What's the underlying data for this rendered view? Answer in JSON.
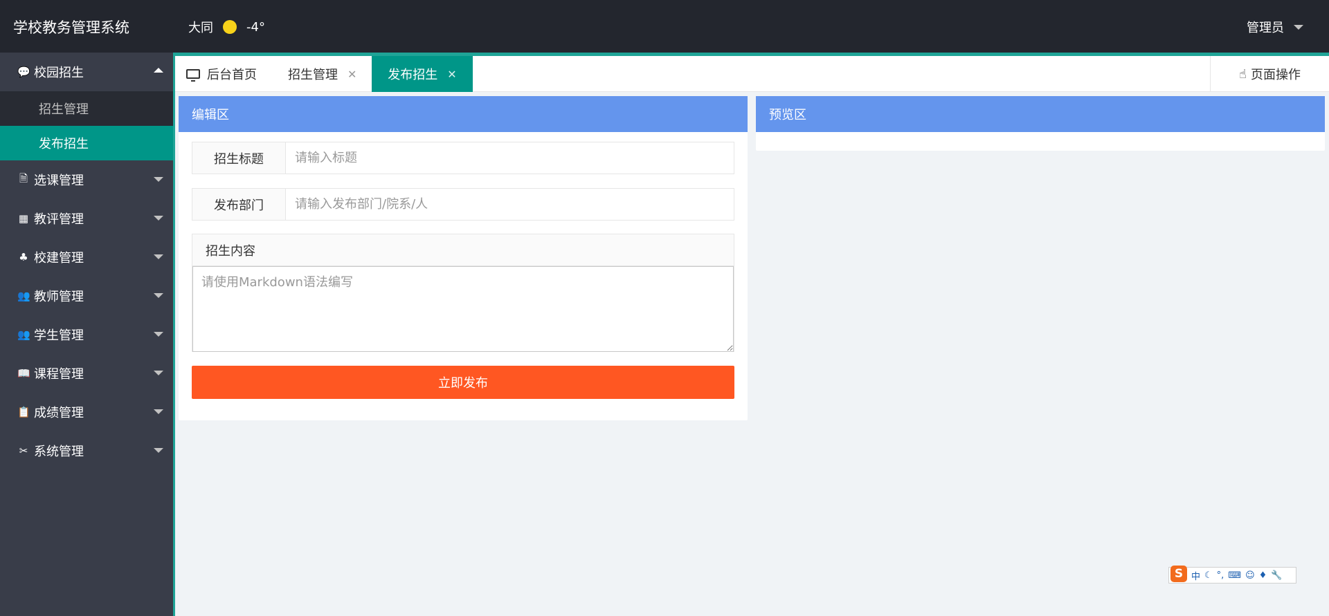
{
  "header": {
    "logo": "学校教务管理系统",
    "city": "大同",
    "temperature": "-4°",
    "user": "管理员"
  },
  "sidebar": {
    "groups": [
      {
        "label": "校园招生",
        "icon": "chat-icon",
        "expanded": true,
        "items": [
          {
            "label": "招生管理",
            "active": false
          },
          {
            "label": "发布招生",
            "active": true
          }
        ]
      },
      {
        "label": "选课管理",
        "icon": "document-icon"
      },
      {
        "label": "教评管理",
        "icon": "grid-icon"
      },
      {
        "label": "校建管理",
        "icon": "tree-icon"
      },
      {
        "label": "教师管理",
        "icon": "users-icon"
      },
      {
        "label": "学生管理",
        "icon": "users-icon"
      },
      {
        "label": "课程管理",
        "icon": "book-icon"
      },
      {
        "label": "成绩管理",
        "icon": "clipboard-icon"
      },
      {
        "label": "系统管理",
        "icon": "tools-icon"
      }
    ]
  },
  "tabs": {
    "home": "后台首页",
    "items": [
      {
        "label": "招生管理"
      },
      {
        "label": "发布招生",
        "active": true
      }
    ],
    "page_ops": "页面操作"
  },
  "edit_panel": {
    "title": "编辑区",
    "title_label": "招生标题",
    "title_placeholder": "请输入标题",
    "dept_label": "发布部门",
    "dept_placeholder": "请输入发布部门/院系/人",
    "content_label": "招生内容",
    "content_placeholder": "请使用Markdown语法编写",
    "publish_button": "立即发布"
  },
  "preview_panel": {
    "title": "预览区"
  },
  "ime": {
    "logo": "S",
    "mode": "中"
  },
  "colors": {
    "header_bg": "#23262e",
    "sidebar_bg": "#393d49",
    "accent": "#009688",
    "panel_header": "#6495ed",
    "publish_button": "#ff5722"
  }
}
